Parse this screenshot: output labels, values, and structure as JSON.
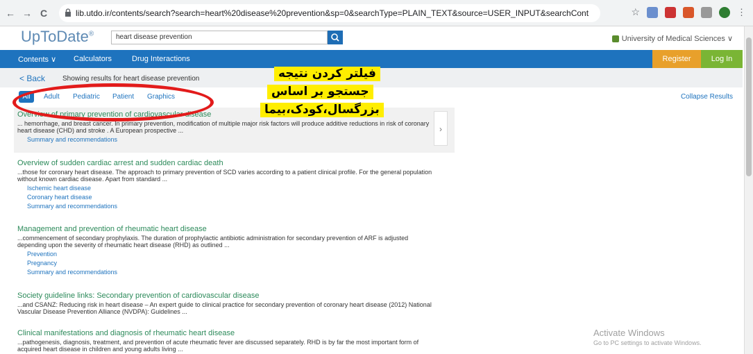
{
  "browser": {
    "url": "lib.utdo.ir/contents/search?search=heart%20disease%20prevention&sp=0&searchType=PLAIN_TEXT&source=USER_INPUT&searchControl=TOP_PULLDOWN&se...",
    "back_glyph": "←",
    "forward_glyph": "→",
    "reload_glyph": "C"
  },
  "app": {
    "logo": "UpToDate",
    "logo_mark": "®",
    "search_value": "heart disease prevention",
    "organization": "University of Medical Sciences ∨",
    "accent": "#1e73be"
  },
  "nav": {
    "contents": "Contents ∨",
    "calculators": "Calculators",
    "drug_interactions": "Drug Interactions",
    "register": "Register",
    "login": "Log In"
  },
  "subheader": {
    "back": "< Back",
    "showing": "Showing results for heart disease prevention"
  },
  "filters": {
    "all": "All",
    "adult": "Adult",
    "pediatric": "Pediatric",
    "patient": "Patient",
    "graphics": "Graphics",
    "collapse": "Collapse Results"
  },
  "annotation": {
    "line1": "فیلتر کردن نتیجه",
    "line2": "جستجو بر اساس",
    "line3": "بزرگسال،کودک،بیما"
  },
  "results": [
    {
      "title": "Overview of primary prevention of cardiovascular disease",
      "snippet": "... hemorrhage, and breast cancer. In primary prevention, modification of multiple major risk factors will produce additive reductions in risk of coronary heart disease (CHD) and stroke . A European prospective ...",
      "subs": [
        "Summary and recommendations"
      ]
    },
    {
      "title": "Overview of sudden cardiac arrest and sudden cardiac death",
      "snippet": "...those for coronary heart disease. The approach to primary prevention of SCD varies according to a patient clinical profile. For the general population without known cardiac disease. Apart from standard ...",
      "subs": [
        "Ischemic heart disease",
        "Coronary heart disease",
        "Summary and recommendations"
      ]
    },
    {
      "title": "Management and prevention of rheumatic heart disease",
      "snippet": "...commencement of secondary prophylaxis. The duration of prophylactic antibiotic administration for secondary prevention of ARF is adjusted depending upon the severity of rheumatic heart disease (RHD) as outlined ...",
      "subs": [
        "Prevention",
        "Pregnancy",
        "Summary and recommendations"
      ]
    },
    {
      "title": "Society guideline links: Secondary prevention of cardiovascular disease",
      "snippet": "...and CSANZ: Reducing risk in heart disease – An expert guide to clinical practice for secondary prevention of coronary heart disease (2012) National Vascular Disease Prevention Alliance (NVDPA): Guidelines ...",
      "subs": []
    },
    {
      "title": "Clinical manifestations and diagnosis of rheumatic heart disease",
      "snippet": "...pathogenesis, diagnosis, treatment, and prevention of acute rheumatic fever are discussed separately. RHD is by far the most important form of acquired heart disease in children and young adults living ...",
      "subs": []
    }
  ],
  "watermark": {
    "line1": "Activate Windows",
    "line2": "Go to PC settings to activate Windows."
  }
}
